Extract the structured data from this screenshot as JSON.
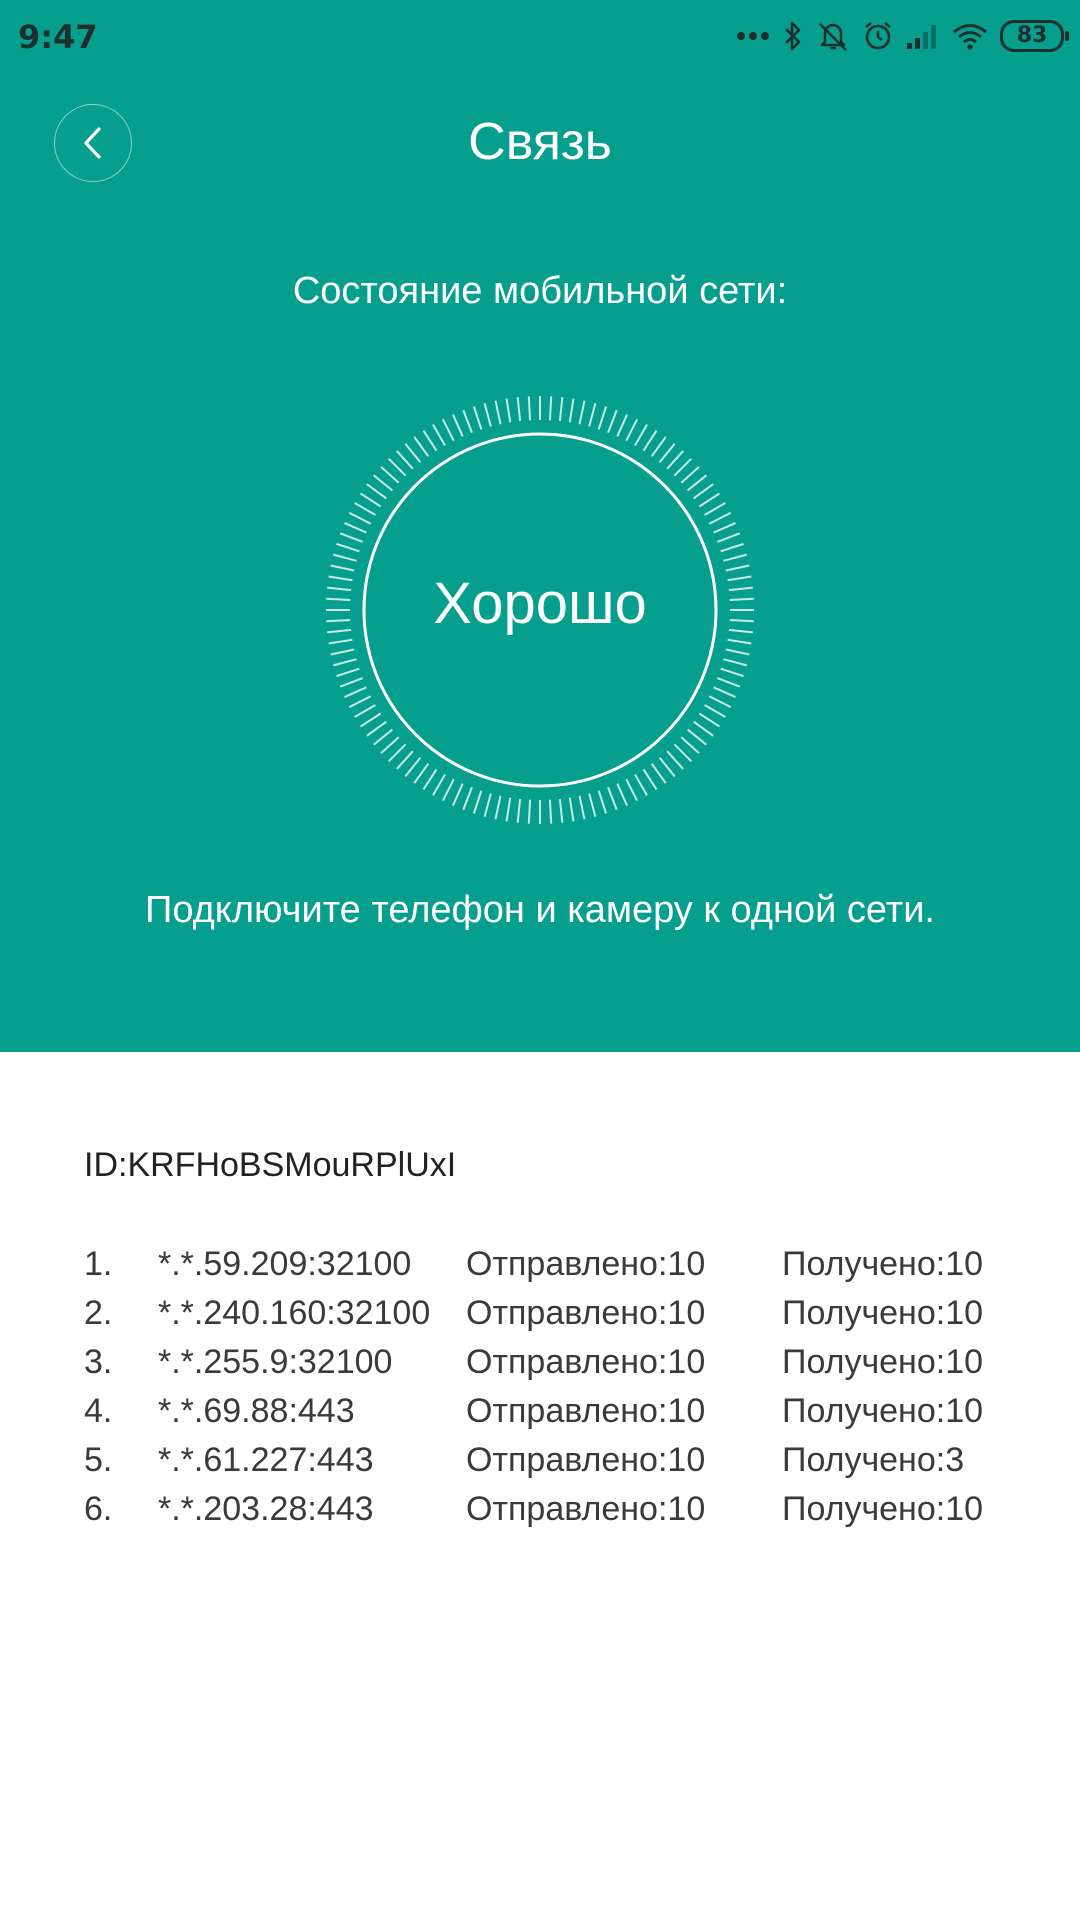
{
  "status_bar": {
    "time": "9:47",
    "battery": "83",
    "icons": [
      "more-dots-icon",
      "bluetooth-icon",
      "mute-icon",
      "alarm-icon",
      "signal-icon",
      "wifi-icon",
      "battery-icon"
    ]
  },
  "header": {
    "title": "Связь",
    "back_icon": "chevron-left-icon",
    "section_label": "Состояние мобильной сети:",
    "status": "Хорошо",
    "hint": "Подключите телефон и камеру к одной сети.",
    "accent_color": "#069e8d"
  },
  "device": {
    "id": "ID:KRFHoBSMouRPlUxI"
  },
  "results": [
    {
      "index": "1.",
      "address": "*.*.59.209:32100",
      "sent": "Отправлено:10",
      "received": "Получено:10"
    },
    {
      "index": "2.",
      "address": "*.*.240.160:32100",
      "sent": "Отправлено:10",
      "received": "Получено:10"
    },
    {
      "index": "3.",
      "address": "*.*.255.9:32100",
      "sent": "Отправлено:10",
      "received": "Получено:10"
    },
    {
      "index": "4.",
      "address": "*.*.69.88:443",
      "sent": "Отправлено:10",
      "received": "Получено:10"
    },
    {
      "index": "5.",
      "address": "*.*.61.227:443",
      "sent": "Отправлено:10",
      "received": "Получено:3"
    },
    {
      "index": "6.",
      "address": "*.*.203.28:443",
      "sent": "Отправлено:10",
      "received": "Получено:10"
    }
  ]
}
